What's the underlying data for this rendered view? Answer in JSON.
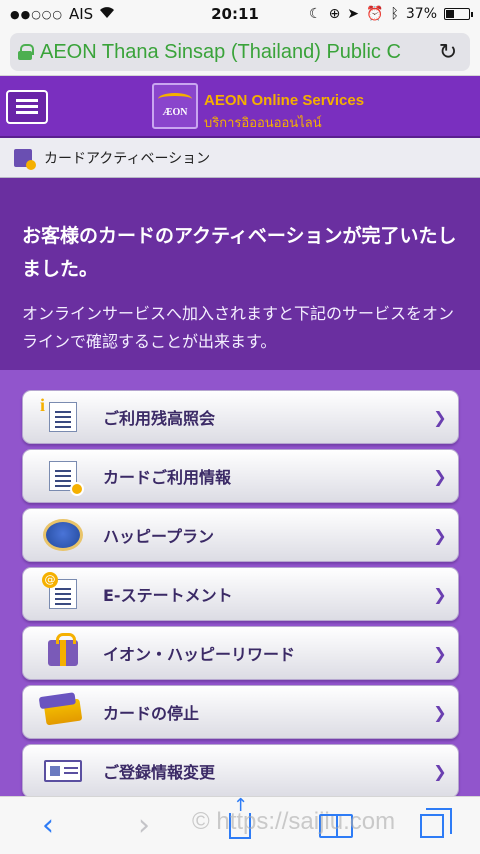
{
  "status_bar": {
    "signal_dots": "●●○○○",
    "carrier": "AIS",
    "time": "20:11",
    "battery_percent": 37,
    "battery_label": "37%"
  },
  "browser": {
    "url_text": "AEON Thana Sinsap (Thailand) Public C",
    "reload_icon": "reload-icon"
  },
  "header": {
    "logo_text": "ÆON",
    "title": "AEON Online Services",
    "subtitle": "บริการอิออนออนไลน์"
  },
  "breadcrumb": {
    "label": "カードアクティベーション"
  },
  "message": {
    "title": "お客様のカードのアクティベーションが完了いたしました。",
    "body": "オンラインサービスへ加入されますと下記のサービスをオンラインで確認することが出来ます。"
  },
  "menu": {
    "items": [
      {
        "label": "ご利用残高照会",
        "icon": "balance-document-icon"
      },
      {
        "label": "カードご利用情報",
        "icon": "bill-clock-icon"
      },
      {
        "label": "ハッピープラン",
        "icon": "globe-icon"
      },
      {
        "label": "E-ステートメント",
        "icon": "email-statement-icon"
      },
      {
        "label": "イオン・ハッピーリワード",
        "icon": "gift-icon"
      },
      {
        "label": "カードの停止",
        "icon": "card-icon"
      },
      {
        "label": "ご登録情報変更",
        "icon": "id-card-icon"
      }
    ],
    "chevron": "❯"
  },
  "toolbar": {
    "back": "‹",
    "forward": "›",
    "watermark": "© https://saijiu.com"
  },
  "colors": {
    "header_purple": "#7a2fbf",
    "panel_purple": "#6a2fa0",
    "menu_bg": "#9155cc",
    "brand_gold": "#f5b000",
    "url_green": "#3aa33a",
    "ios_blue": "#2e7cf6"
  }
}
